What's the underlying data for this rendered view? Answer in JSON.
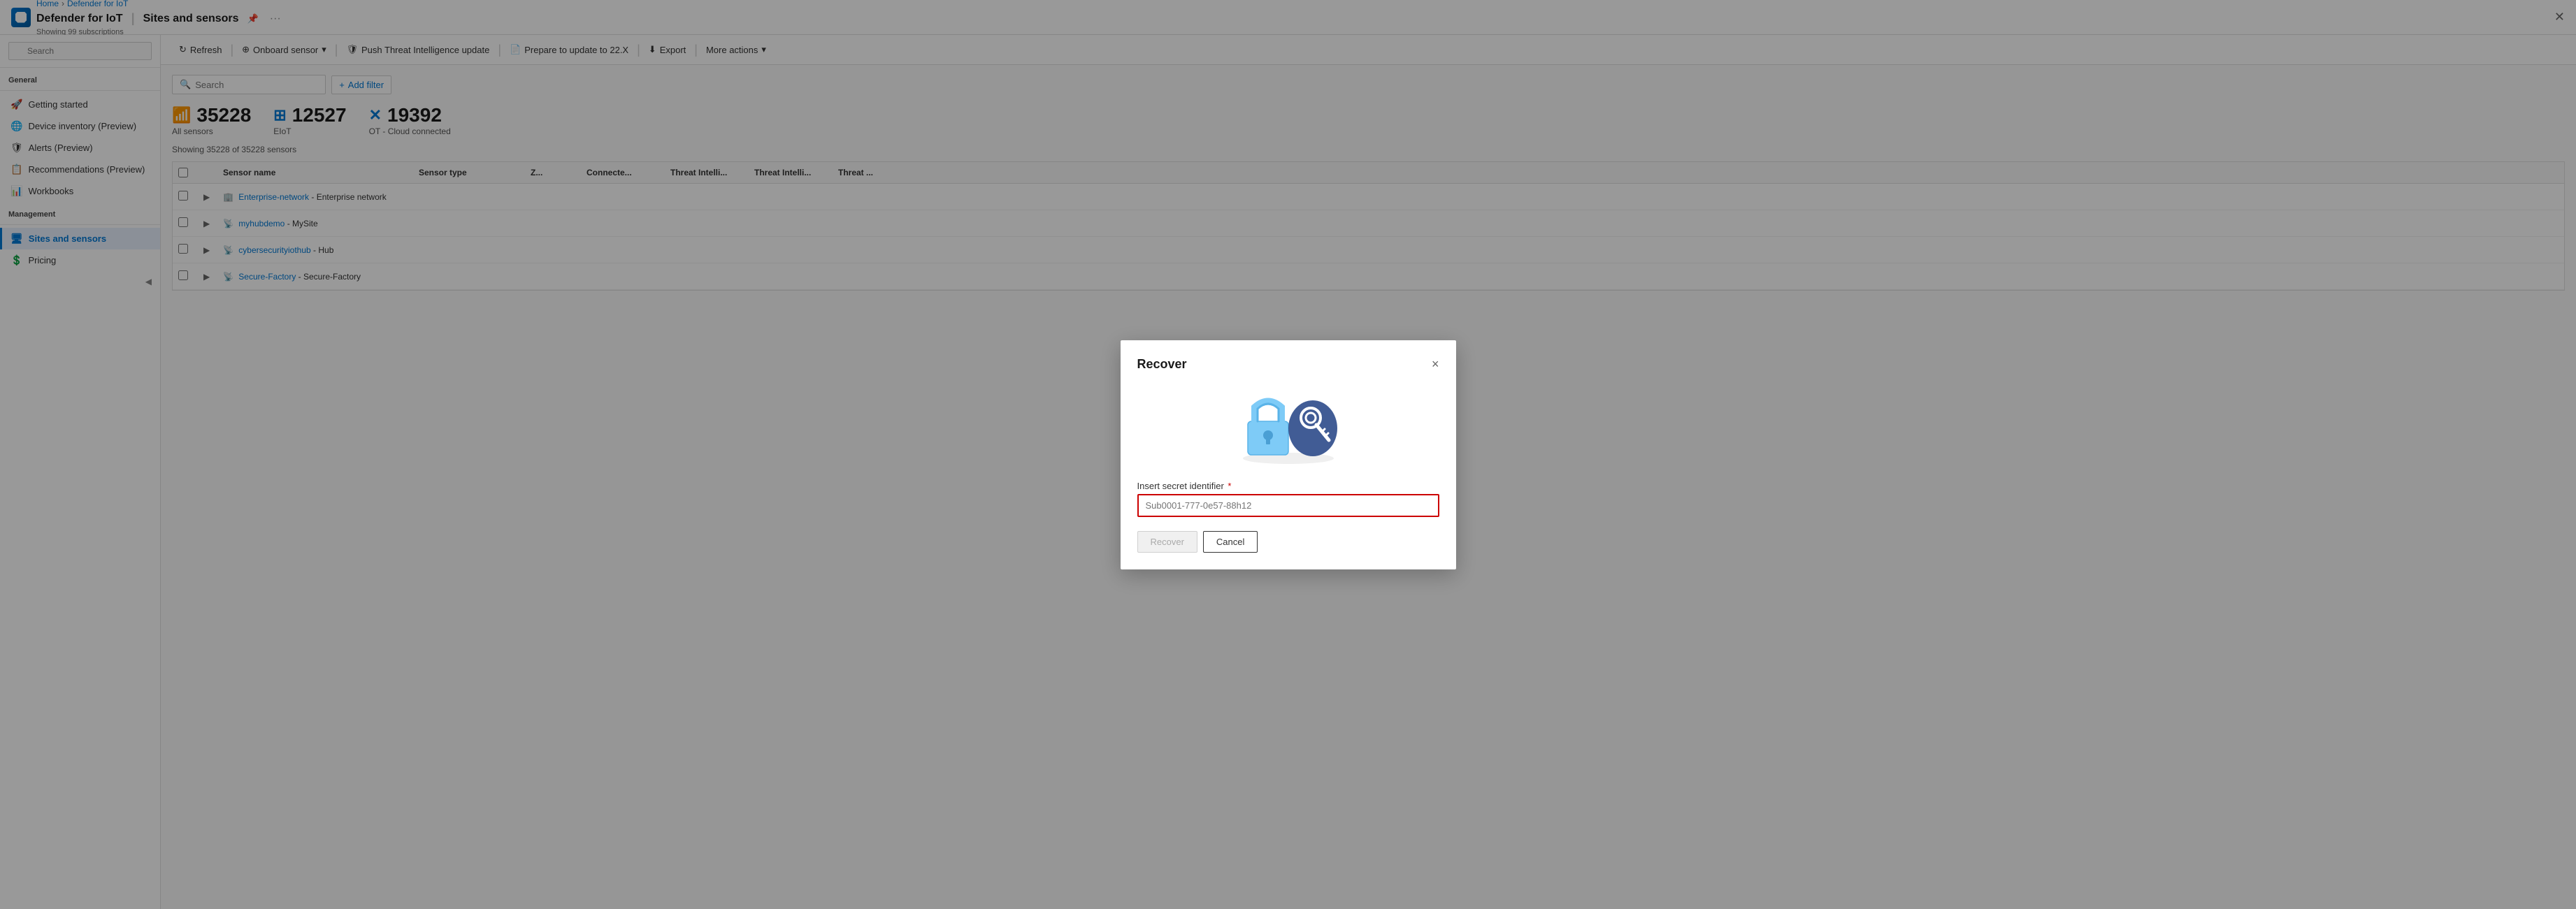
{
  "app": {
    "icon_label": "defender-icon",
    "title": "Defender for IoT",
    "section": "Sites and sensors",
    "subtitle": "Showing 99 subscriptions",
    "pin_label": "pin",
    "more_label": "..."
  },
  "breadcrumb": {
    "home": "Home",
    "parent": "Defender for IoT"
  },
  "toolbar": {
    "refresh": "Refresh",
    "onboard_sensor": "Onboard sensor",
    "push_threat": "Push Threat Intelligence update",
    "prepare_update": "Prepare to update to 22.X",
    "export": "Export",
    "more_actions": "More actions"
  },
  "filter": {
    "search_placeholder": "Search",
    "add_filter": "Add filter"
  },
  "stats": [
    {
      "id": "all-sensors",
      "number": "35228",
      "label": "All sensors",
      "icon": "wifi"
    },
    {
      "id": "eiot",
      "number": "12527",
      "label": "EIoT",
      "icon": "grid"
    },
    {
      "id": "ot-cloud",
      "number": "19392",
      "label": "OT - Cloud connected",
      "icon": "cross"
    }
  ],
  "sensors_count": "Showing 35228 of 35228 sensors",
  "table": {
    "columns": [
      "",
      "",
      "Sensor name",
      "Sensor type",
      "Z...",
      "Connecte...",
      "Threat Intelli...",
      "Threat Intelli...",
      "Threat ..."
    ],
    "rows": [
      {
        "name": "Enterprise-network",
        "suffix": " - Enterprise network",
        "type": "",
        "link": true
      },
      {
        "name": "myhubdemo",
        "suffix": " - MySite",
        "type": "",
        "link": true
      },
      {
        "name": "cybersecurityiothub",
        "suffix": " - Hub",
        "type": "",
        "link": true
      },
      {
        "name": "Secure-Factory",
        "suffix": " - Secure-Factory",
        "type": "",
        "link": true
      }
    ]
  },
  "sidebar": {
    "search_placeholder": "Search",
    "general_label": "General",
    "items_general": [
      {
        "id": "getting-started",
        "label": "Getting started",
        "icon": "🚀"
      },
      {
        "id": "device-inventory",
        "label": "Device inventory (Preview)",
        "icon": "🌐"
      },
      {
        "id": "alerts",
        "label": "Alerts (Preview)",
        "icon": "🛡"
      },
      {
        "id": "recommendations",
        "label": "Recommendations (Preview)",
        "icon": "📋"
      },
      {
        "id": "workbooks",
        "label": "Workbooks",
        "icon": "📊"
      }
    ],
    "management_label": "Management",
    "items_management": [
      {
        "id": "sites-and-sensors",
        "label": "Sites and sensors",
        "icon": "🖥",
        "active": true
      },
      {
        "id": "pricing",
        "label": "Pricing",
        "icon": "💲"
      }
    ]
  },
  "dialog": {
    "title": "Recover",
    "close_label": "×",
    "field_label": "Insert secret identifier",
    "field_required": "*",
    "field_placeholder": "Sub0001-777-0e57-88h12",
    "btn_recover": "Recover",
    "btn_cancel": "Cancel"
  }
}
